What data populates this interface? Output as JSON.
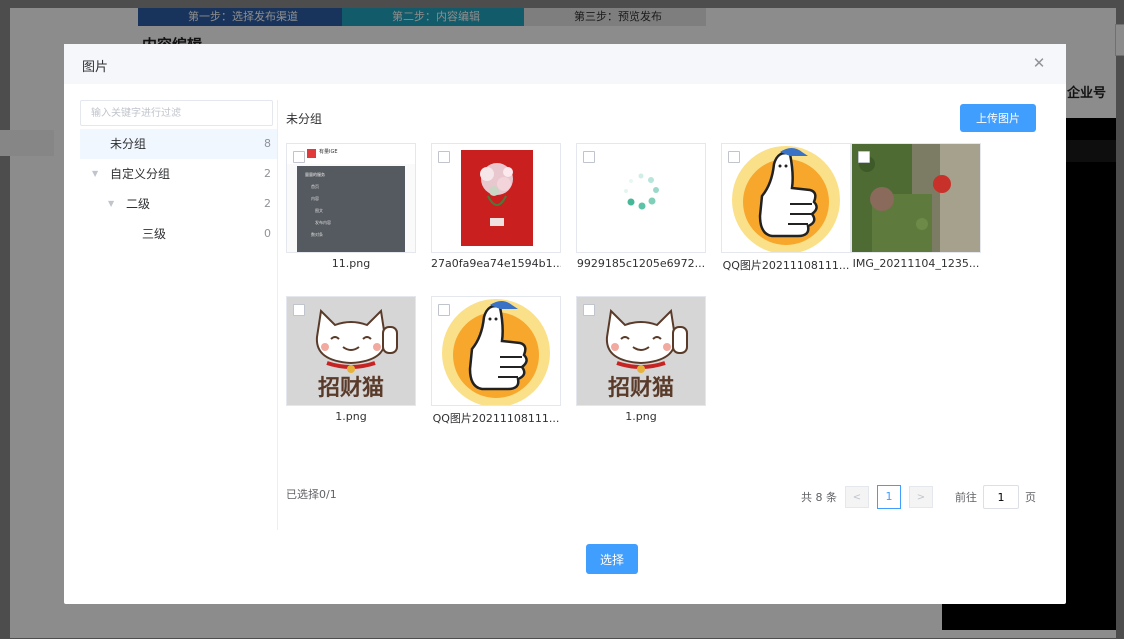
{
  "background": {
    "steps": [
      "第一步：选择发布渠道",
      "第二步：内容编辑",
      "第三步：预览发布"
    ],
    "section_title": "内容编辑",
    "right_label": "企业号"
  },
  "dialog": {
    "title": "图片",
    "close_icon": "close-icon"
  },
  "sidebar": {
    "filter_placeholder": "输入关键字进行过滤",
    "nodes": [
      {
        "label": "未分组",
        "count": "8",
        "active": true
      },
      {
        "label": "自定义分组",
        "count": "2"
      },
      {
        "label": "二级",
        "count": "2"
      },
      {
        "label": "三级",
        "count": "0"
      }
    ]
  },
  "main": {
    "group_title": "未分组",
    "upload_label": "上传图片",
    "images": [
      {
        "name": "11.png",
        "kind": "screenshot"
      },
      {
        "name": "27a0fa9ea74e1594b1...",
        "kind": "flowers"
      },
      {
        "name": "9929185c1205e6972...",
        "kind": "loading"
      },
      {
        "name": "QQ图片20211108111...",
        "kind": "thumbsup"
      },
      {
        "name": "IMG_20211104_1235...",
        "kind": "photo"
      },
      {
        "name": "1.png",
        "kind": "luckycat"
      },
      {
        "name": "QQ图片20211108111...",
        "kind": "thumbsup"
      },
      {
        "name": "1.png",
        "kind": "luckycat"
      }
    ],
    "thumb_text": {
      "brand": "有量IGE",
      "menu_title": "量量的服务",
      "menu_items": [
        "首页",
        "内容",
        "图文",
        "发布内容",
        "数对条"
      ],
      "luckycat_text": "招财猫"
    },
    "selected_text": "已选择0/1"
  },
  "pagination": {
    "total": "共 8 条",
    "prev": "<",
    "current": "1",
    "next": ">",
    "goto_label": "前往",
    "goto_value": "1",
    "page_suffix": "页"
  },
  "footer": {
    "confirm_label": "选择"
  },
  "colors": {
    "primary": "#409eff",
    "overlay": "rgba(0,0,0,0.45)"
  }
}
